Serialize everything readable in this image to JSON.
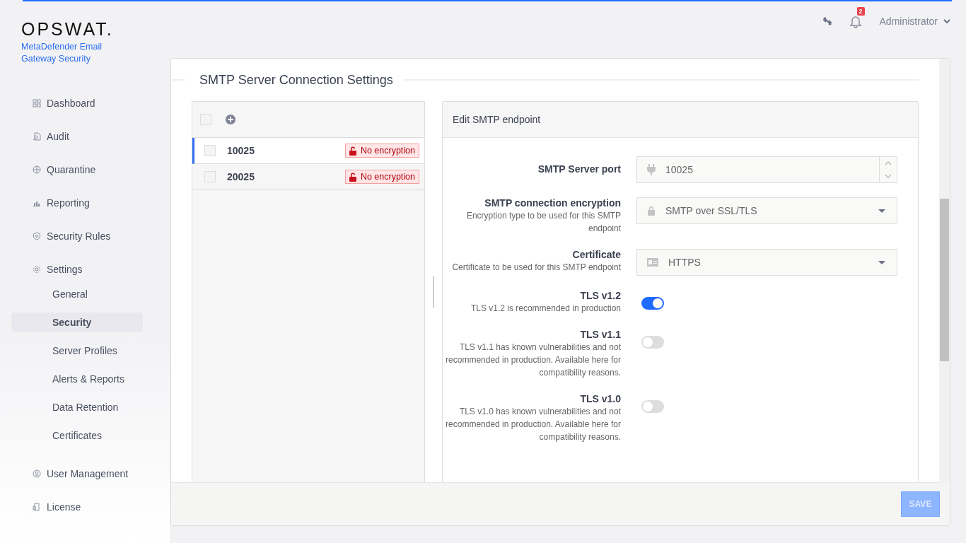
{
  "brand": {
    "logo": "OPSWAT.",
    "product": "MetaDefender Email Gateway Security"
  },
  "nav": [
    {
      "label": "Dashboard",
      "selected": false
    },
    {
      "label": "Audit",
      "selected": false
    },
    {
      "label": "Quarantine",
      "selected": false
    },
    {
      "label": "Reporting",
      "selected": false
    },
    {
      "label": "Security Rules",
      "selected": false
    },
    {
      "label": "Settings",
      "selected": false,
      "children": [
        {
          "label": "General",
          "selected": false
        },
        {
          "label": "Security",
          "selected": true
        },
        {
          "label": "Server Profiles",
          "selected": false
        },
        {
          "label": "Alerts & Reports",
          "selected": false
        },
        {
          "label": "Data Retention",
          "selected": false
        },
        {
          "label": "Certificates",
          "selected": false
        }
      ]
    },
    {
      "label": "User Management",
      "selected": false
    },
    {
      "label": "License",
      "selected": false
    }
  ],
  "header": {
    "notifications": "2",
    "user": "Administrator"
  },
  "page_title": "SMTP Server Connection Settings",
  "endpoints": {
    "select_all_checked": false,
    "rows": [
      {
        "port": "10025",
        "encryption": "No encryption",
        "selected": true,
        "checked": false
      },
      {
        "port": "20025",
        "encryption": "No encryption",
        "selected": false,
        "checked": false
      }
    ]
  },
  "editor": {
    "title": "Edit SMTP endpoint",
    "fields": [
      {
        "kind": "number",
        "label": "SMTP Server port",
        "value": "10025"
      },
      {
        "kind": "select",
        "label": "SMTP connection encryption",
        "description": "Encryption type to be used for this SMTP endpoint",
        "value": "SMTP over SSL/TLS"
      },
      {
        "kind": "select",
        "label": "Certificate",
        "description": "Certificate to be used for this SMTP endpoint",
        "value": "HTTPS"
      },
      {
        "kind": "toggle",
        "label": "TLS v1.2",
        "description": "TLS v1.2 is recommended in production",
        "on": true
      },
      {
        "kind": "toggle",
        "label": "TLS v1.1",
        "description": "TLS v1.1 has known vulnerabilities and not recommended in production. Available here for compatibility reasons.",
        "on": false
      },
      {
        "kind": "toggle",
        "label": "TLS v1.0",
        "description": "TLS v1.0 has known vulnerabilities and not recommended in production. Available here for compatibility reasons.",
        "on": false
      }
    ]
  },
  "save": {
    "label": "SAVE",
    "disabled": true
  }
}
